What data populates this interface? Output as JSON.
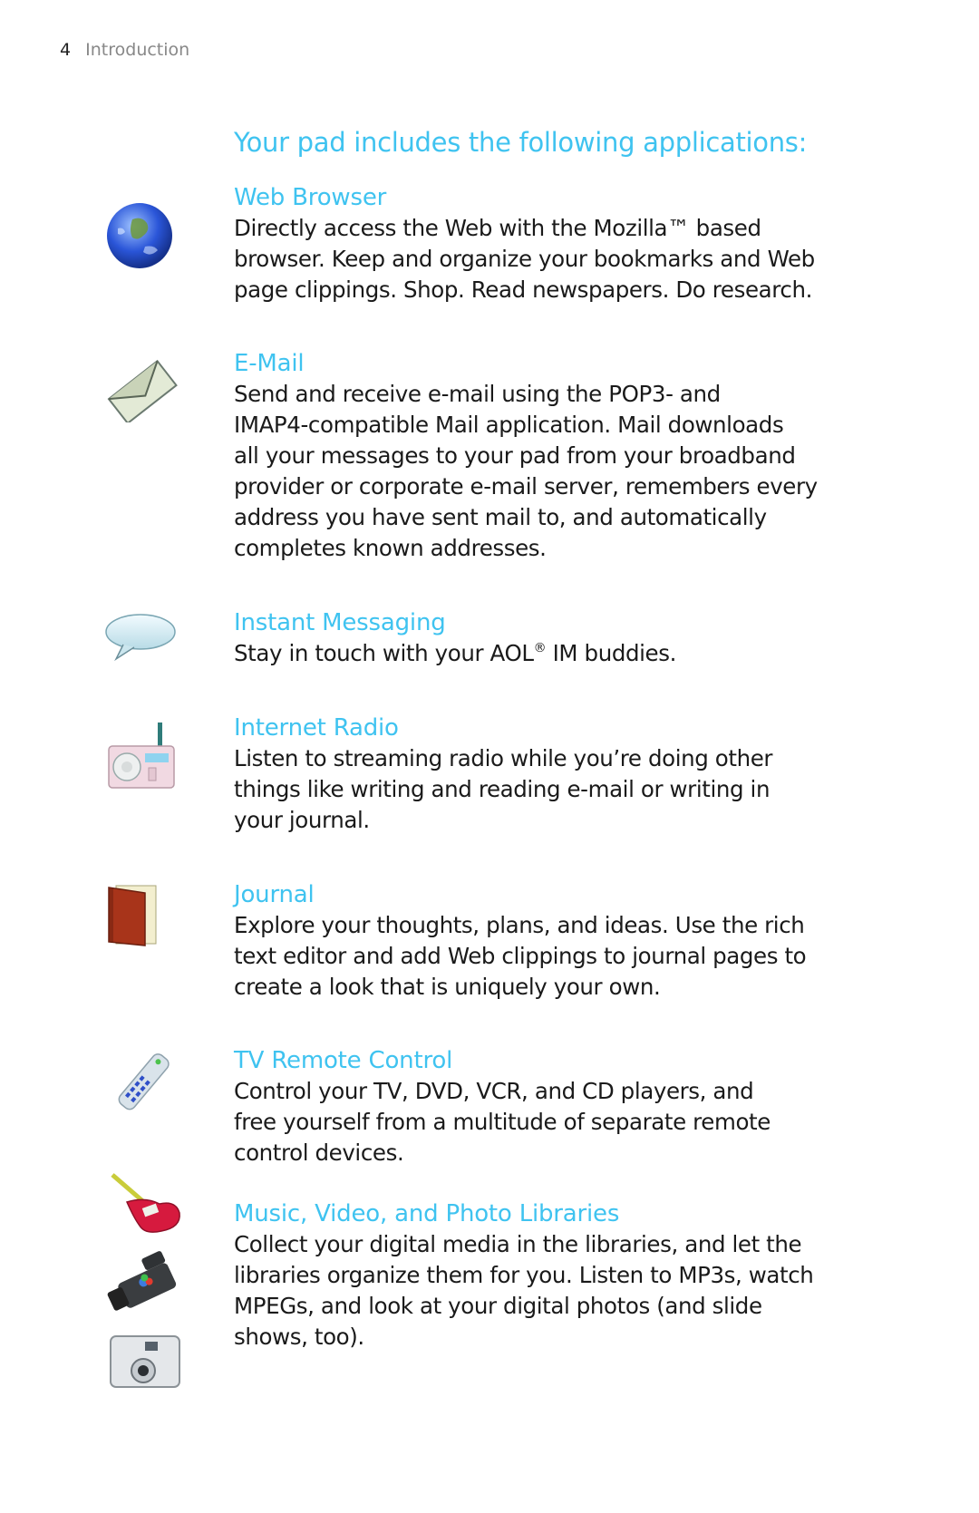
{
  "running_head": {
    "page_number": "4",
    "section": "Introduction"
  },
  "title": "Your pad includes the following applications:",
  "apps": [
    {
      "heading": "Web Browser",
      "icon": "globe-icon",
      "lines": [
        "Directly access the Web with the Mozilla™ based",
        "browser. Keep and organize your bookmarks and Web",
        "page clippings. Shop. Read newspapers. Do research."
      ]
    },
    {
      "heading": "E-Mail",
      "icon": "envelope-icon",
      "lines": [
        "Send and receive e-mail using the POP3- and",
        "IMAP4-compatible Mail application. Mail downloads",
        "all your messages to your pad from your broadband",
        "provider or corporate e-mail server, remembers every",
        "address you have sent mail to, and automatically",
        "completes known addresses."
      ]
    },
    {
      "heading": "Instant Messaging",
      "icon": "speech-bubble-icon",
      "line_pre": "Stay in touch with your AOL",
      "line_sup": "®",
      "line_post": " IM buddies."
    },
    {
      "heading": "Internet Radio",
      "icon": "radio-icon",
      "lines": [
        "Listen to streaming radio while you’re doing other",
        "things like writing and reading e-mail or writing in",
        "your journal."
      ]
    },
    {
      "heading": "Journal",
      "icon": "journal-book-icon",
      "lines": [
        "Explore your thoughts, plans, and ideas. Use the rich",
        "text editor and add Web clippings to journal pages to",
        "create a look that is uniquely your own."
      ]
    },
    {
      "heading": "TV Remote Control",
      "icon": "remote-control-icon",
      "lines": [
        "Control your TV, DVD, VCR, and CD players, and",
        "free yourself from a multitude of separate remote",
        "control devices."
      ]
    },
    {
      "heading": "Music, Video, and Photo Libraries",
      "icons": [
        "guitar-icon",
        "camcorder-icon",
        "camera-icon"
      ],
      "lines": [
        "Collect your digital media in the libraries, and let the",
        "libraries organize them for you. Listen to MP3s, watch",
        "MPEGs, and look at your digital photos (and slide",
        "shows, too)."
      ]
    }
  ]
}
